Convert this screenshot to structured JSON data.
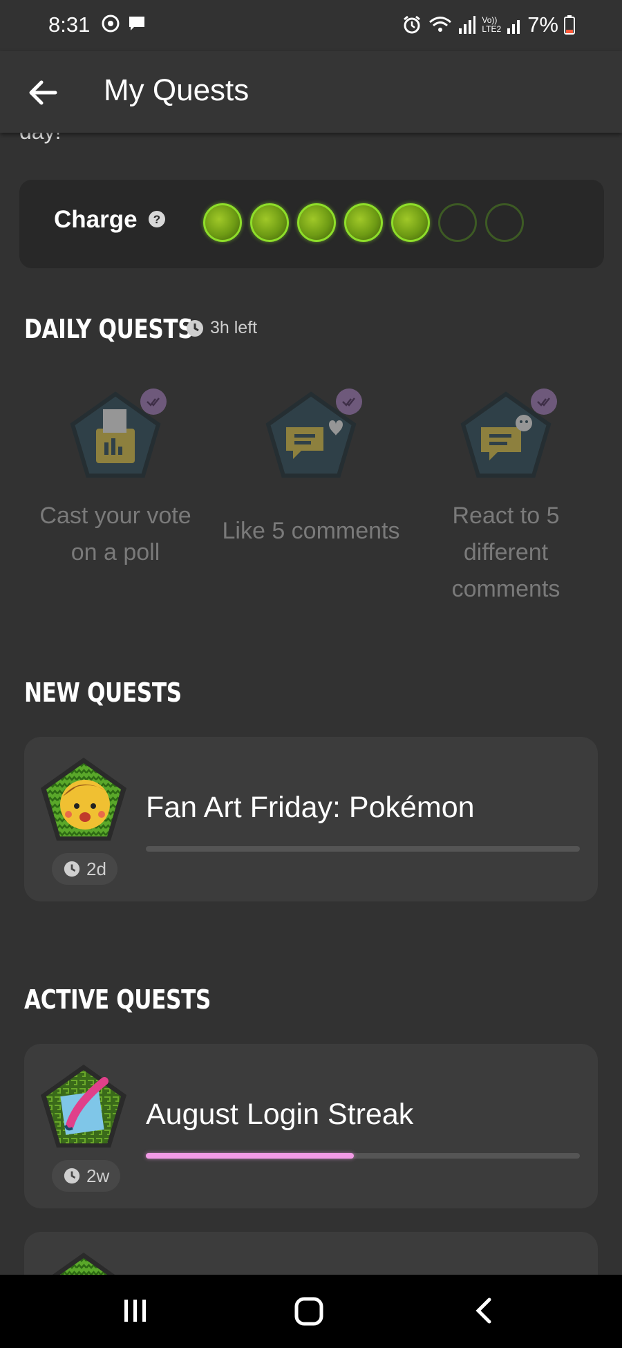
{
  "status_bar": {
    "time": "8:31",
    "battery": "7%",
    "network_label_top": "Vo))",
    "network_label_bottom": "LTE2"
  },
  "header": {
    "title": "My Quests"
  },
  "intro_clipped_text": "day!",
  "charge": {
    "label": "Charge",
    "filled": 5,
    "total": 7
  },
  "daily": {
    "title": "DAILY QUESTS",
    "time_left": "3h left",
    "quests": [
      {
        "label": "Cast your vote on a poll",
        "icon": "ballot-box-icon"
      },
      {
        "label": "Like 5 comments",
        "icon": "chat-heart-icon"
      },
      {
        "label": "React to 5 different comments",
        "icon": "chat-emoji-icon"
      }
    ]
  },
  "new_quests": {
    "title": "NEW QUESTS",
    "items": [
      {
        "title": "Fan Art Friday: Pokémon",
        "duration": "2d",
        "progress": 0
      }
    ]
  },
  "active_quests": {
    "title": "ACTIVE QUESTS",
    "items": [
      {
        "title": "August Login Streak",
        "duration": "2w",
        "progress": 0.48
      }
    ]
  },
  "colors": {
    "background": "#323232",
    "card": "#3c3c3c",
    "charge_green": "#8ede2a",
    "progress_pink": "#f29ae6",
    "check_purple": "#a07ab8"
  }
}
